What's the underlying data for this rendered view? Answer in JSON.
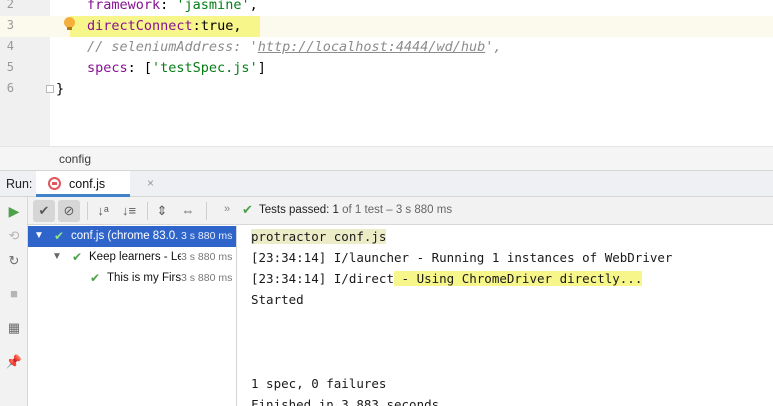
{
  "editor": {
    "lines": [
      {
        "number": "2",
        "key": "framework",
        "sep": ": ",
        "value": "'jasmine'",
        "trail": ","
      },
      {
        "number": "3",
        "key": "directConnect",
        "sep": ":",
        "value": "true",
        "trail": ","
      },
      {
        "number": "4",
        "comment_pre": "// seleniumAddress: '",
        "comment_url": "http://localhost:4444/wd/hub",
        "comment_post": "',"
      },
      {
        "number": "5",
        "key": "specs",
        "sep": ": [",
        "value": "'testSpec.js'",
        "trail": "]"
      },
      {
        "number": "6",
        "text": "}"
      }
    ]
  },
  "breadcrumb": {
    "label": "config"
  },
  "run_panel": {
    "label": "Run:",
    "tab": {
      "label": "conf.js",
      "close": "×"
    }
  },
  "toolbar": {
    "sort_alpha_icon": "↓ᵃ",
    "sort_duration_icon": "↓≡",
    "expand_icon": "⇕",
    "collapse_icon": "⇔",
    "chevron": "»",
    "status_prefix": "Tests passed:",
    "status_count": "1",
    "status_suffix": "of 1 test – 3 s 880 ms"
  },
  "tree": {
    "rows": [
      {
        "label": "conf.js (chrome 83.0.",
        "time": "3 s 880 ms",
        "selected": true
      },
      {
        "label": "Keep learners - Le",
        "time": "3 s 880 ms",
        "selected": false
      },
      {
        "label": "This is my Firs",
        "time": "3 s 880 ms",
        "selected": false
      }
    ]
  },
  "console": {
    "lines": [
      "protractor conf.js",
      "[23:34:14] I/launcher - Running 1 instances of WebDriver",
      "[23:34:14] I/direct",
      " - Using ChromeDriver directly...",
      "Started",
      "1 spec, 0 failures",
      "Finished in 3.883 seconds"
    ]
  },
  "colors": {
    "highlight_yellow": "#f7f68a",
    "selection_blue": "#2f65ca",
    "pass_green": "#4da14a",
    "keyword_purple": "#871094",
    "string_green": "#067d17"
  }
}
